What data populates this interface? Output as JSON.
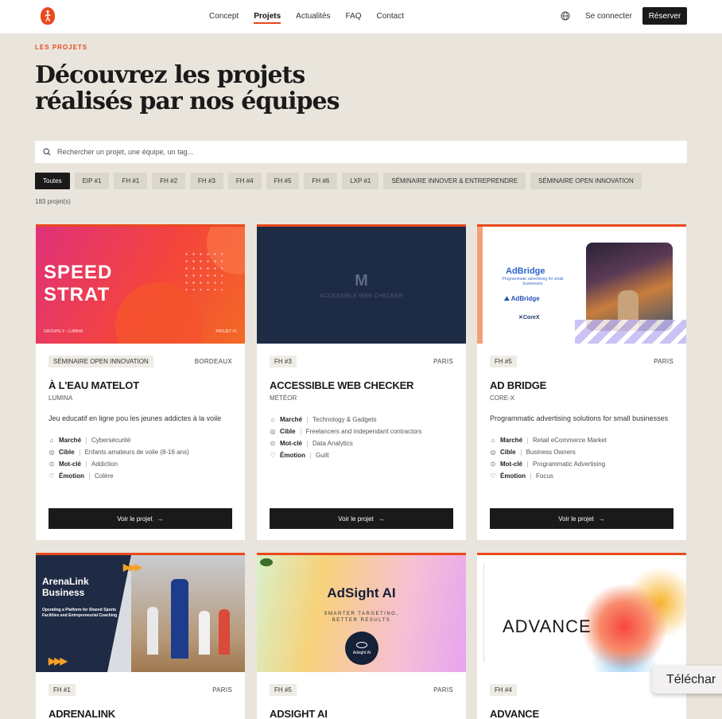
{
  "nav": {
    "links": [
      "Concept",
      "Projets",
      "Actualités",
      "FAQ",
      "Contact"
    ],
    "active": "Projets",
    "login": "Se connecter",
    "reserve": "Réserver",
    "accent": "#e8491d"
  },
  "header": {
    "eyebrow": "LES PROJETS",
    "title": "Découvrez les projets réalisés par nos équipes"
  },
  "search": {
    "placeholder": "Rechercher un projet, une équipe, un tag..."
  },
  "filters": [
    "Toutes",
    "EIP #1",
    "FH #1",
    "FH #2",
    "FH #3",
    "FH #4",
    "FH #5",
    "FH #6",
    "LXP #1",
    "SÉMINAIRE INNOVER & ENTREPRENDRE",
    "SÉMINAIRE OPEN INNOVATION"
  ],
  "filters_active": "Toutes",
  "count": "183 projet(s)",
  "cta_label": "Voir le projet",
  "meta_labels": {
    "market": "Marché",
    "target": "Cible",
    "keyword": "Mot-clé",
    "emotion": "Émotion"
  },
  "cards": [
    {
      "badge": "SÉMINAIRE OPEN INNOVATION",
      "city": "BORDEAUX",
      "title": "À L'EAU MATELOT",
      "team": "LUMINA",
      "desc": "Jeu educatif en ligne pou les jeunes addictes à la voile",
      "market": "Cybersécurité",
      "target": "Enfants amateurs de voile (8-16 ans)",
      "keyword": "Addiction",
      "emotion": "Colère",
      "cover": {
        "word1": "SPEED",
        "word2": "STRAT",
        "foot_left": "GROUPE 3 - LUMINA",
        "foot_right": "PROJET #1"
      }
    },
    {
      "badge": "FH #3",
      "city": "PARIS",
      "title": "ACCESSIBLE WEB CHECKER",
      "team": "MÉTÉOR",
      "desc": "",
      "market": "Technology & Gadgets",
      "target": "Freelancers and independant contractors",
      "keyword": "Data Analytics",
      "emotion": "Guilt",
      "cover": {
        "letter": "M",
        "text": "ACCESSIBLE WEB CHECKER"
      }
    },
    {
      "badge": "FH #5",
      "city": "PARIS",
      "title": "AD BRIDGE",
      "team": "CORE-X",
      "desc": "Programmatic advertising solutions for small businesses",
      "market": "Retail eCommerce Market",
      "target": "Business Owners",
      "keyword": "Programmatic Advertising",
      "emotion": "Focus",
      "cover": {
        "name": "AdBridge",
        "tagline": "Programmatic advertising for small businesses",
        "logo": "AdBridge",
        "corex": "CoreX"
      }
    },
    {
      "badge": "FH #1",
      "city": "PARIS",
      "title": "ADRENALINK",
      "cover": {
        "title1": "ArenaLink",
        "title2": "Business",
        "subtitle": "Operating a Platform for Shared Sports Facilities and Entrepreneurial Coaching"
      }
    },
    {
      "badge": "FH #5",
      "city": "PARIS",
      "title": "ADSIGHT AI",
      "cover": {
        "headline": "AdSight AI",
        "sub1": "SMARTER TARGETING,",
        "sub2": "BETTER RESULTS",
        "logo": "Adsight AI"
      }
    },
    {
      "badge": "FH #4",
      "city": "",
      "title": "ADVANCE",
      "cover": {
        "word": "ADVANCE"
      }
    }
  ],
  "download_label": "Téléchar"
}
